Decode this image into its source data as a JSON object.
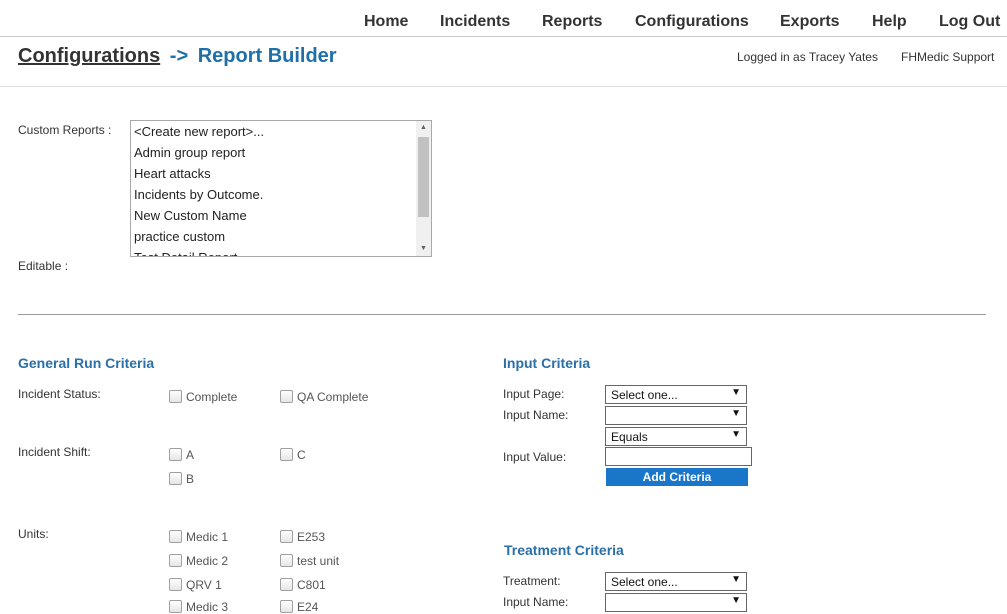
{
  "nav": {
    "items": [
      {
        "label": "Home"
      },
      {
        "label": "Incidents"
      },
      {
        "label": "Reports"
      },
      {
        "label": "Configurations"
      },
      {
        "label": "Exports"
      },
      {
        "label": "Help"
      },
      {
        "label": "Log Out"
      }
    ]
  },
  "header": {
    "crumb": "Configurations",
    "arrow": "->",
    "title": "Report Builder",
    "logged_in": "Logged in as Tracey Yates",
    "org": "FHMedic Support"
  },
  "custom_reports": {
    "label": "Custom Reports :",
    "options": [
      "<Create new report>...",
      "Admin group report",
      "Heart attacks",
      "Incidents by Outcome.",
      "New Custom Name",
      "practice custom",
      "Test Detail Report"
    ],
    "editable_label": "Editable :"
  },
  "general": {
    "title": "General Run Criteria",
    "status_label": "Incident Status:",
    "status_options": [
      "Complete",
      "QA Complete"
    ],
    "shift_label": "Incident Shift:",
    "shift_options": [
      "A",
      "C",
      "B"
    ],
    "units_label": "Units:",
    "units_options": [
      "Medic 1",
      "E253",
      "Medic 2",
      "test unit",
      "QRV 1",
      "C801",
      "Medic 3",
      "E24"
    ]
  },
  "input": {
    "title": "Input Criteria",
    "page_label": "Input Page:",
    "page_value": "Select one...",
    "name_label": "Input Name:",
    "name_value": "",
    "operator_value": "Equals",
    "value_label": "Input Value:",
    "value_text": "",
    "add_button": "Add Criteria"
  },
  "treatment": {
    "title": "Treatment Criteria",
    "treatment_label": "Treatment:",
    "treatment_value": "Select one...",
    "name_label": "Input Name:",
    "name_value": ""
  }
}
